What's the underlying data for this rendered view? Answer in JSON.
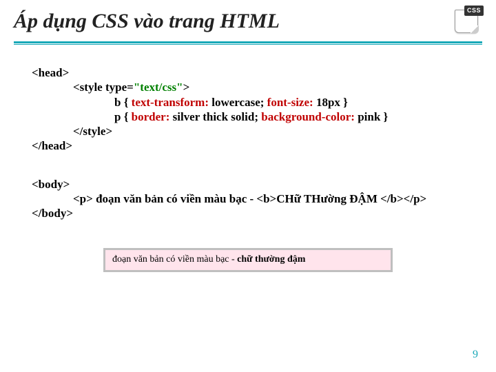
{
  "header": {
    "title": "Áp dụng CSS vào trang HTML",
    "corner_badge": "CSS"
  },
  "code": {
    "head_open": "<head>",
    "style_open_a": "<style type=",
    "style_open_b": "\"text/css\"",
    "style_open_c": ">",
    "rule1_a": "b { ",
    "rule1_b": "text-transform:",
    "rule1_c": " lowercase;  ",
    "rule1_d": "font-size:",
    "rule1_e": " 18px }",
    "rule2_a": "p { ",
    "rule2_b": "border:",
    "rule2_c": " silver thick solid;  ",
    "rule2_d": "background-color:",
    "rule2_e": " pink }",
    "style_close": "</style>",
    "head_close": "</head>",
    "body_open": "<body>",
    "para_a": "<p> đoạn văn bản có viền màu bạc - <b>",
    "para_b": "CHữ THường ĐẬM ",
    "para_c": "</b></p>",
    "body_close": "</body>"
  },
  "output": {
    "text_normal": "đoạn văn bản có viền màu bạc - ",
    "text_bold_lower": "chữ thường đậm"
  },
  "page_number": "9"
}
